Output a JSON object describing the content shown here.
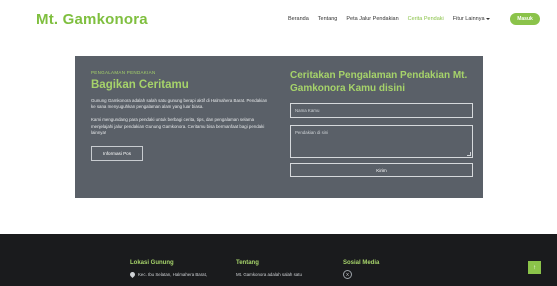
{
  "brand": "Mt. Gamkonora",
  "nav": {
    "items": [
      "Beranda",
      "Tentang",
      "Peta Jalur Pendakian",
      "Cerita Pendaki",
      "Fitur Lainnya"
    ],
    "active": "Cerita Pendaki",
    "login": "Masuk"
  },
  "story": {
    "eyebrow": "PENGALAMAN PENDAKIAN",
    "title": "Bagikan Ceritamu",
    "para1": "Gunung Gamkonora adalah salah satu gunung berapi aktif di Halmahera Barat. Pendakian ke sana menyuguhkan pengalaman alam yang luar biasa.",
    "para2": "Kami mengundang para pendaki untuk berbagi cerita, tips, dan pengalaman selama menjelajahi jalur pendakian Gunung Gamkonora. Ceritamu bisa bermanfaat bagi pendaki lainnya!",
    "info_button": "Informasi Pos"
  },
  "form": {
    "title": "Ceritakan Pengalaman Pendakian Mt. Gamkonora Kamu disini",
    "name_placeholder": "Nama Kamu",
    "story_placeholder": "Pendakian di sini",
    "submit": "Kirim"
  },
  "footer": {
    "location_heading": "Lokasi Gunung",
    "location_text": "Kec. Ibu Selatan, Halmahera Barat,",
    "about_heading": "Tentang",
    "about_text": "Mt. Gamkonora adalah salah satu",
    "social_heading": "Sosial Media",
    "social_icon_label": "X",
    "to_top": "↑"
  },
  "colors": {
    "accent": "#8bc34a",
    "brand": "#7fbf3f",
    "card_bg": "#5a6068",
    "footer_bg": "#1a1b1d"
  }
}
